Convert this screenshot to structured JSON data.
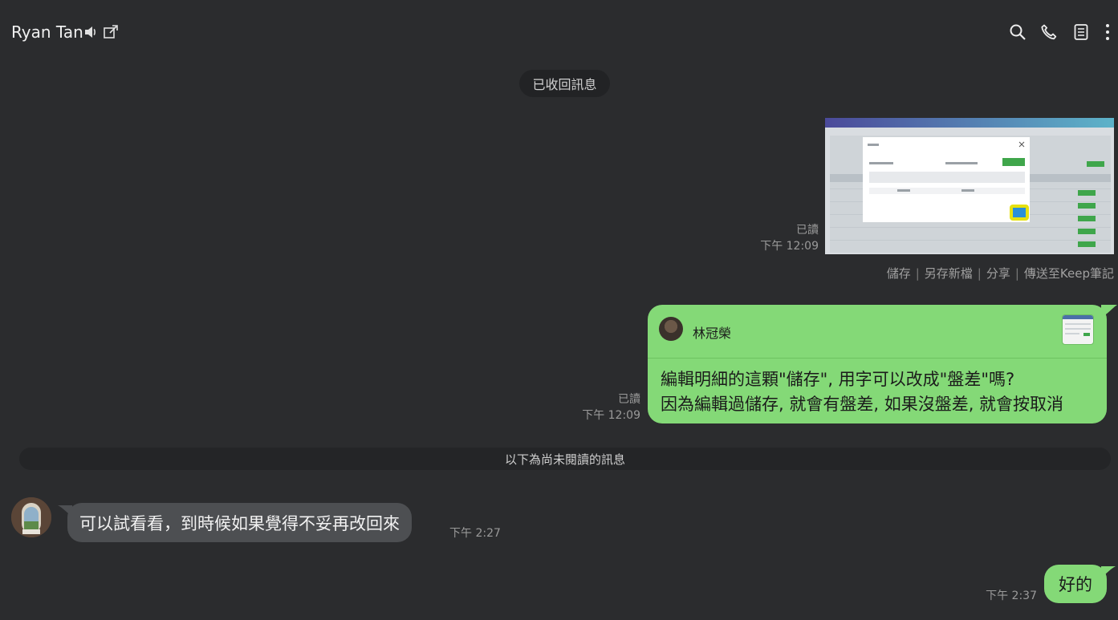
{
  "header": {
    "title": "Ryan Tan",
    "icons": [
      "speaker-icon",
      "popout-icon",
      "search-icon",
      "phone-icon",
      "notes-icon",
      "more-icon"
    ]
  },
  "system": {
    "recalled": "已收回訊息"
  },
  "image_message": {
    "read": "已讀",
    "time": "下午 12:09",
    "actions": [
      "儲存",
      "另存新檔",
      "分享",
      "傳送至Keep筆記"
    ]
  },
  "reply_message": {
    "quoted_name": "林冠榮",
    "text": "編輯明細的這顆\"儲存\", 用字可以改成\"盤差\"嗎?\n因為編輯過儲存, 就會有盤差, 如果沒盤差, 就會按取消",
    "read": "已讀",
    "time": "下午 12:09"
  },
  "unread_divider": "以下為尚未閱讀的訊息",
  "incoming_message": {
    "text": "可以試看看，到時候如果覺得不妥再改回來",
    "time": "下午 2:27"
  },
  "outgoing_message": {
    "text": "好的",
    "time": "下午 2:37"
  },
  "colors": {
    "background": "#2b2c2e",
    "bubble_green": "#84d977",
    "bubble_gray": "#4d4f52"
  }
}
